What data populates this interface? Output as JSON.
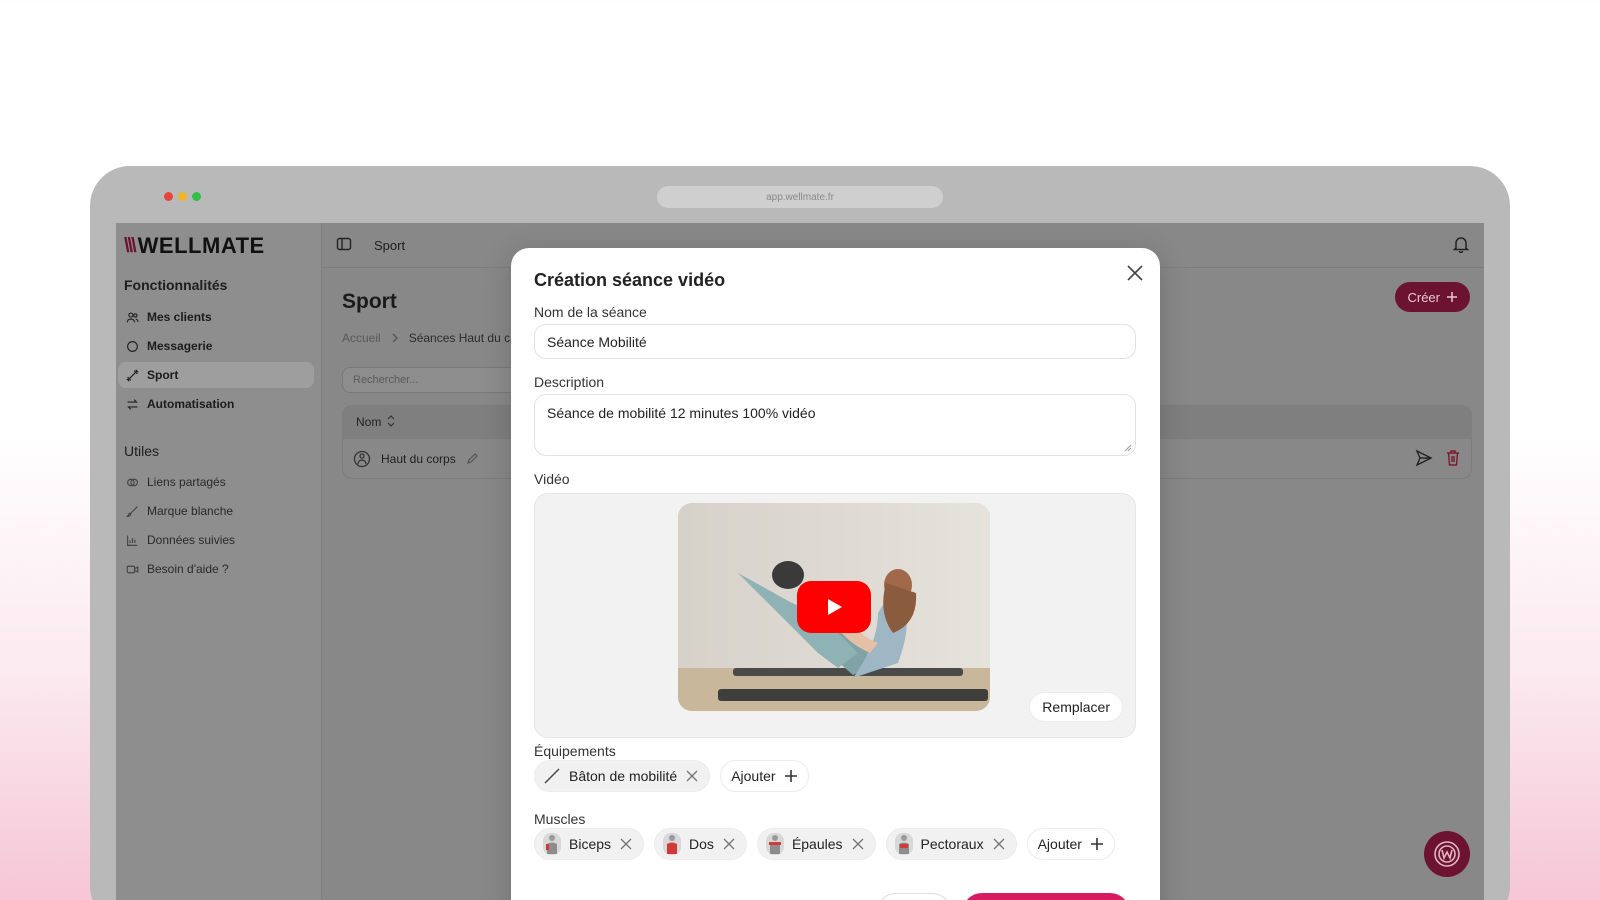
{
  "browser": {
    "url": "app.wellmate.fr",
    "dot_colors": [
      "#ff5f57",
      "#febc2e",
      "#28c840"
    ]
  },
  "app": {
    "brand": "WELLMATE",
    "accent": "#6b1330",
    "primary": "#d81b60"
  },
  "sidebar": {
    "section_features": "Fonctionnalités",
    "features": [
      {
        "label": "Mes clients",
        "icon": "users-icon"
      },
      {
        "label": "Messagerie",
        "icon": "chat-icon"
      },
      {
        "label": "Sport",
        "icon": "dumbbell-icon",
        "active": true
      },
      {
        "label": "Automatisation",
        "icon": "arrows-icon"
      }
    ],
    "section_utils": "Utiles",
    "utils": [
      {
        "label": "Liens partagés",
        "icon": "link-icon"
      },
      {
        "label": "Marque blanche",
        "icon": "brush-icon"
      },
      {
        "label": "Données suivies",
        "icon": "chart-icon"
      },
      {
        "label": "Besoin d'aide ?",
        "icon": "video-icon"
      }
    ]
  },
  "topbar": {
    "title": "Sport"
  },
  "page": {
    "title": "Sport",
    "breadcrumb_home": "Accueil",
    "breadcrumb_current": "Séances Haut du c",
    "search_placeholder": "Rechercher...",
    "create_label": "Créer",
    "table_col_name": "Nom",
    "row_name": "Haut du corps"
  },
  "modal": {
    "title": "Création séance vidéo",
    "name_label": "Nom de la séance",
    "name_value": "Séance Mobilité",
    "description_label": "Description",
    "description_value": "Séance de mobilité 12 minutes 100% vidéo",
    "video_label": "Vidéo",
    "replace_label": "Remplacer",
    "equipment_label": "Équipements",
    "equipment": [
      {
        "label": "Bâton de mobilité"
      }
    ],
    "muscles_label": "Muscles",
    "muscles": [
      {
        "label": "Biceps"
      },
      {
        "label": "Dos"
      },
      {
        "label": "Épaules"
      },
      {
        "label": "Pectoraux"
      }
    ],
    "add_label": "Ajouter"
  }
}
